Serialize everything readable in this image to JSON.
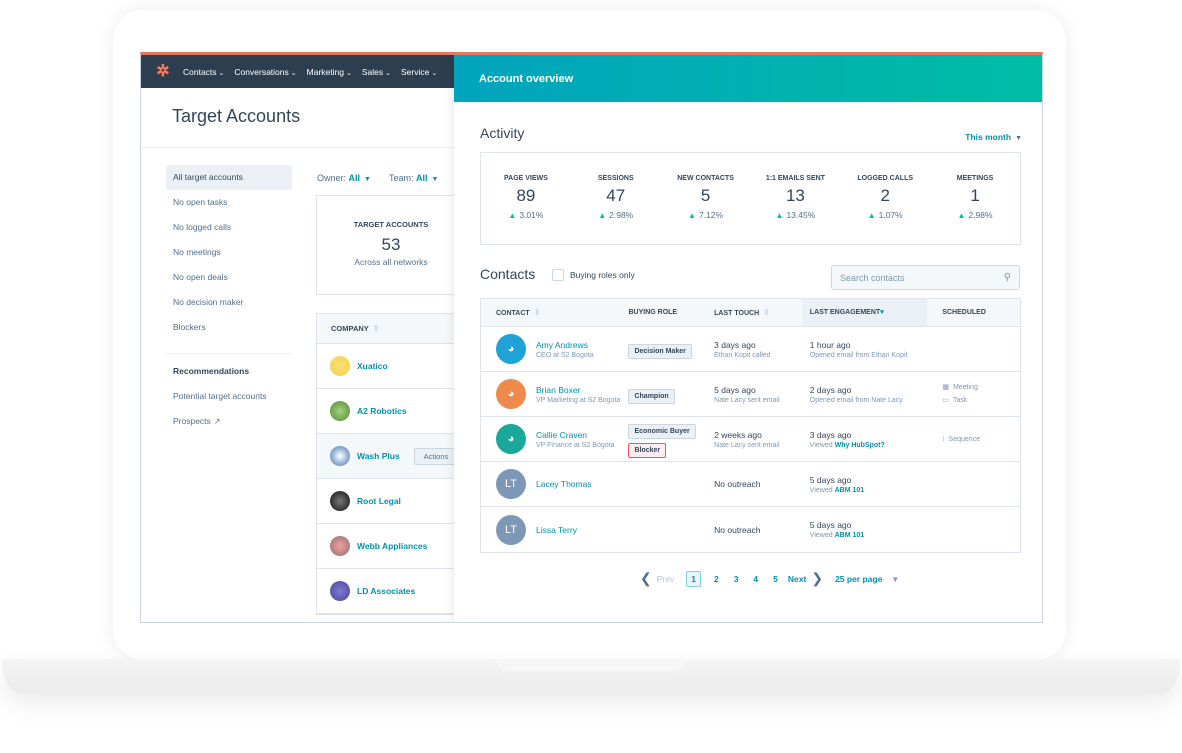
{
  "nav": {
    "logo": "hubspot-logo",
    "items": [
      {
        "label": "Contacts"
      },
      {
        "label": "Conversations"
      },
      {
        "label": "Marketing"
      },
      {
        "label": "Sales"
      },
      {
        "label": "Service"
      }
    ],
    "chevron": "⌄"
  },
  "page": {
    "title": "Target Accounts"
  },
  "sidebar": {
    "items": [
      {
        "label": "All target accounts",
        "active": true
      },
      {
        "label": "No open tasks"
      },
      {
        "label": "No logged calls"
      },
      {
        "label": "No meetings"
      },
      {
        "label": "No open deals"
      },
      {
        "label": "No decision maker"
      },
      {
        "label": "Blockers"
      }
    ],
    "recommendations_heading": "Recommendations",
    "recommendations": [
      {
        "label": "Potential target accounts"
      },
      {
        "label": "Prospects",
        "external": true
      }
    ]
  },
  "filters": {
    "owner_label": "Owner:",
    "owner_value": "All",
    "team_label": "Team:",
    "team_value": "All"
  },
  "kpi": {
    "label": "TARGET ACCOUNTS",
    "value": "53",
    "sub": "Across all networks"
  },
  "company_table": {
    "header": "COMPANY",
    "rows": [
      {
        "name": "Xuatico",
        "color": "#f5d142"
      },
      {
        "name": "A2 Robotics",
        "color": "#6aa84f"
      },
      {
        "name": "Wash Plus",
        "color": "#3d6fb6",
        "action": "Actions"
      },
      {
        "name": "Root Legal",
        "color": "#222222"
      },
      {
        "name": "Webb Appliances",
        "color": "#d98b8b"
      },
      {
        "name": "LD Associates",
        "color": "#5c56b0"
      }
    ]
  },
  "panel": {
    "title": "Account overview",
    "activity_title": "Activity",
    "period": "This month",
    "stats": [
      {
        "label": "PAGE VIEWS",
        "value": "89",
        "change": "3.01%"
      },
      {
        "label": "SESSIONS",
        "value": "47",
        "change": "2.98%"
      },
      {
        "label": "NEW CONTACTS",
        "value": "5",
        "change": "7.12%"
      },
      {
        "label": "1:1 EMAILS SENT",
        "value": "13",
        "change": "13.45%"
      },
      {
        "label": "LOGGED CALLS",
        "value": "2",
        "change": "1.07%"
      },
      {
        "label": "MEETINGS",
        "value": "1",
        "change": "2.98%"
      }
    ],
    "contacts_title": "Contacts",
    "buying_roles_label": "Buying roles only",
    "search_placeholder": "Search contacts",
    "columns": {
      "contact": "CONTACT",
      "buying_role": "BUYING ROLE",
      "last_touch": "LAST TOUCH",
      "last_engagement": "LAST ENGAGEMENT",
      "scheduled": "SCHEDULED"
    },
    "contacts": [
      {
        "name": "Amy Andrews",
        "title": "CEO at S2 Bogota",
        "avatar_color": "#1fa3d6",
        "roles": [
          "Decision Maker"
        ],
        "touch": "3 days ago",
        "touch_sub": "Ethan Kopit called",
        "engagement": "1 hour ago",
        "engagement_sub": "Opened email from Ethan Kopit",
        "engagement_link": "",
        "scheduled": []
      },
      {
        "name": "Brian Boxer",
        "title": "VP Marketing at S2 Bogota",
        "avatar_color": "#f08a4b",
        "roles": [
          "Champion"
        ],
        "touch": "5 days ago",
        "touch_sub": "Nate Lacy sent email",
        "engagement": "2 days ago",
        "engagement_sub": "Opened email from Nate Lacy",
        "engagement_link": "",
        "scheduled": [
          "Meeting",
          "Task"
        ]
      },
      {
        "name": "Callie Craven",
        "title": "VP Finance at S2 Bogota",
        "avatar_color": "#1aa89b",
        "roles": [
          "Economic Buyer"
        ],
        "blocker": "Blocker",
        "touch": "2 weeks ago",
        "touch_sub": "Nate Lacy sent email",
        "engagement": "3 days ago",
        "engagement_sub": "Viewed",
        "engagement_link": "Why HubSpot?",
        "scheduled": [
          "Sequence"
        ]
      },
      {
        "name": "Lacey Thomas",
        "initials": "LT",
        "touch": "No outreach",
        "engagement": "5 days ago",
        "engagement_sub": "Viewed",
        "engagement_link": "ABM 101"
      },
      {
        "name": "Lissa Terry",
        "initials": "LT",
        "touch": "No outreach",
        "engagement": "5 days ago",
        "engagement_sub": "Viewed",
        "engagement_link": "ABM 101"
      }
    ],
    "pagination": {
      "prev": "Prev",
      "pages": [
        "1",
        "2",
        "3",
        "4",
        "5"
      ],
      "current": "1",
      "next": "Next",
      "per_page": "25 per page"
    }
  }
}
